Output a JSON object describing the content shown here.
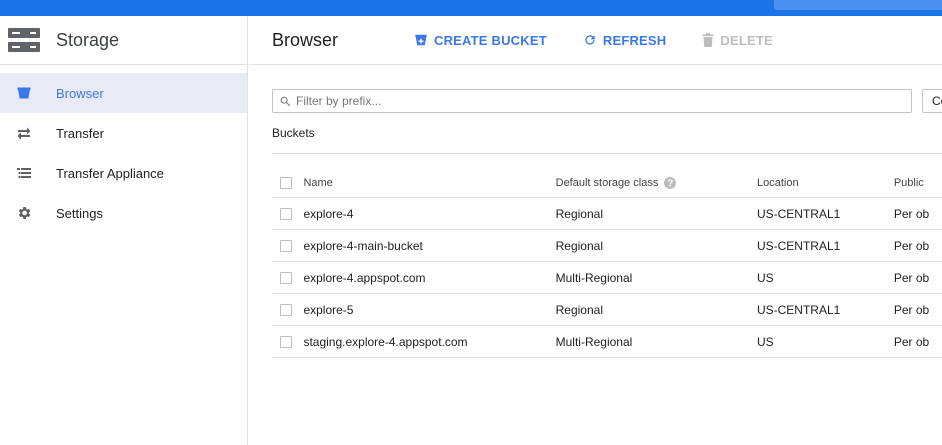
{
  "app": {
    "title": "Storage"
  },
  "sidebar": {
    "items": [
      {
        "label": "Browser",
        "icon": "bucket-icon",
        "active": true
      },
      {
        "label": "Transfer",
        "icon": "transfer-arrows-icon"
      },
      {
        "label": "Transfer Appliance",
        "icon": "list-icon"
      },
      {
        "label": "Settings",
        "icon": "gear-icon"
      }
    ]
  },
  "toolbar": {
    "title": "Browser",
    "create_label": "CREATE BUCKET",
    "refresh_label": "REFRESH",
    "delete_label": "DELETE"
  },
  "filter": {
    "placeholder": "Filter by prefix...",
    "columns_label": "Co"
  },
  "section": {
    "label": "Buckets"
  },
  "table": {
    "headers": {
      "name": "Name",
      "class": "Default storage class",
      "location": "Location",
      "public": "Public"
    },
    "rows": [
      {
        "name": "explore-4",
        "class": "Regional",
        "location": "US-CENTRAL1",
        "public": "Per ob"
      },
      {
        "name": "explore-4-main-bucket",
        "class": "Regional",
        "location": "US-CENTRAL1",
        "public": "Per ob"
      },
      {
        "name": "explore-4.appspot.com",
        "class": "Multi-Regional",
        "location": "US",
        "public": "Per ob"
      },
      {
        "name": "explore-5",
        "class": "Regional",
        "location": "US-CENTRAL1",
        "public": "Per ob"
      },
      {
        "name": "staging.explore-4.appspot.com",
        "class": "Multi-Regional",
        "location": "US",
        "public": "Per ob"
      }
    ]
  },
  "colors": {
    "accent": "#3b78e7",
    "topbar": "#1a73e8",
    "disabled": "#bdbdbd"
  }
}
